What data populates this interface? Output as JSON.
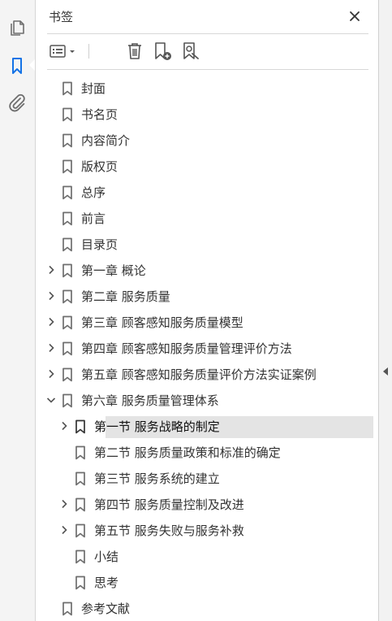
{
  "rail": {
    "pages_icon": "pages-icon",
    "bookmarks_icon": "bookmark-icon",
    "attachments_icon": "paperclip-icon",
    "active": "bookmarks"
  },
  "panel": {
    "title": "书签",
    "close_icon": "close-icon"
  },
  "toolbar": {
    "options_icon": "list-options-icon",
    "delete_icon": "trash-icon",
    "new_bookmark_icon": "bookmark-add-icon",
    "find_bookmark_icon": "bookmark-search-icon"
  },
  "bookmarks": [
    {
      "label": "封面",
      "level": 0,
      "expander": "none"
    },
    {
      "label": "书名页",
      "level": 0,
      "expander": "none"
    },
    {
      "label": "内容简介",
      "level": 0,
      "expander": "none"
    },
    {
      "label": "版权页",
      "level": 0,
      "expander": "none"
    },
    {
      "label": "总序",
      "level": 0,
      "expander": "none"
    },
    {
      "label": "前言",
      "level": 0,
      "expander": "none"
    },
    {
      "label": "目录页",
      "level": 0,
      "expander": "none"
    },
    {
      "label": "第一章  概论",
      "level": 0,
      "expander": "collapsed"
    },
    {
      "label": "第二章  服务质量",
      "level": 0,
      "expander": "collapsed"
    },
    {
      "label": "第三章  顾客感知服务质量模型",
      "level": 0,
      "expander": "collapsed"
    },
    {
      "label": "第四章  顾客感知服务质量管理评价方法",
      "level": 0,
      "expander": "collapsed"
    },
    {
      "label": "第五章  顾客感知服务质量评价方法实证案例",
      "level": 0,
      "expander": "collapsed"
    },
    {
      "label": "第六章  服务质量管理体系",
      "level": 0,
      "expander": "expanded"
    },
    {
      "label": "第一节  服务战略的制定",
      "level": 1,
      "expander": "collapsed",
      "selected": true
    },
    {
      "label": "第二节  服务质量政策和标准的确定",
      "level": 1,
      "expander": "none"
    },
    {
      "label": "第三节  服务系统的建立",
      "level": 1,
      "expander": "none"
    },
    {
      "label": "第四节  服务质量控制及改进",
      "level": 1,
      "expander": "collapsed"
    },
    {
      "label": "第五节  服务失败与服务补救",
      "level": 1,
      "expander": "collapsed"
    },
    {
      "label": "小结",
      "level": 1,
      "expander": "none"
    },
    {
      "label": "思考",
      "level": 1,
      "expander": "none"
    },
    {
      "label": "参考文献",
      "level": 0,
      "expander": "none"
    }
  ],
  "colors": {
    "rail_bg": "#f4f4f4",
    "active_icon": "#1473e6",
    "icon_gray": "#6e6e6e",
    "selection_bg": "#e4e4e4"
  }
}
